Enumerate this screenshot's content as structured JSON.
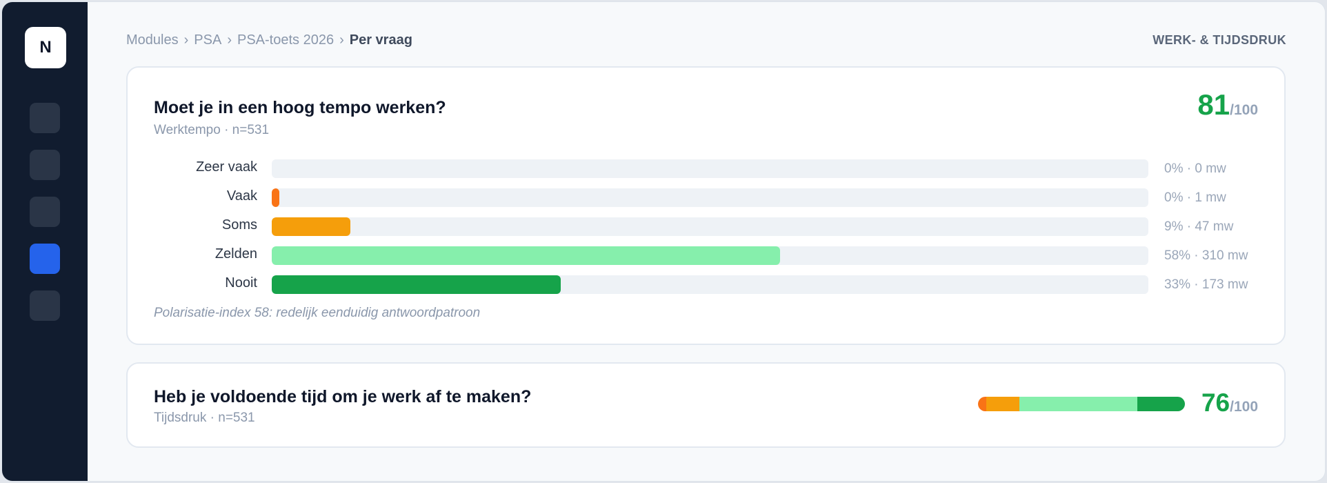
{
  "app": {
    "logo_letter": "N"
  },
  "breadcrumb": {
    "items": [
      "Modules",
      "PSA",
      "PSA-toets 2026"
    ],
    "current": "Per vraag",
    "separator": "›"
  },
  "section_label": "WERK- & TIJDSDRUK",
  "questions": [
    {
      "title": "Moet je in een hoog tempo werken?",
      "subtitle": "Werktempo · n=531",
      "score": "81",
      "score_max": "/100",
      "answers": [
        {
          "label": "Zeer vaak",
          "percent": 0,
          "stat": "0% · 0 mw",
          "color": "#dc2626"
        },
        {
          "label": "Vaak",
          "percent": 0.9,
          "stat": "0% · 1 mw",
          "color": "#f97316"
        },
        {
          "label": "Soms",
          "percent": 9,
          "stat": "9% · 47 mw",
          "color": "#f59e0b"
        },
        {
          "label": "Zelden",
          "percent": 58,
          "stat": "58% · 310 mw",
          "color": "#86efac"
        },
        {
          "label": "Nooit",
          "percent": 33,
          "stat": "33% · 173 mw",
          "color": "#16a34a"
        }
      ],
      "note": "Polarisatie-index 58: redelijk eenduidig antwoordpatroon"
    },
    {
      "title": "Heb je voldoende tijd om je werk af te maken?",
      "subtitle": "Tijdsdruk · n=531",
      "score": "76",
      "score_max": "/100",
      "distribution": [
        {
          "percent": 4,
          "color": "#f97316"
        },
        {
          "percent": 16,
          "color": "#f59e0b"
        },
        {
          "percent": 57,
          "color": "#86efac"
        },
        {
          "percent": 23,
          "color": "#16a34a"
        }
      ]
    }
  ],
  "colors": {
    "accent": "#2563eb",
    "score": "#16a34a",
    "sidebar": "#111c2f"
  }
}
